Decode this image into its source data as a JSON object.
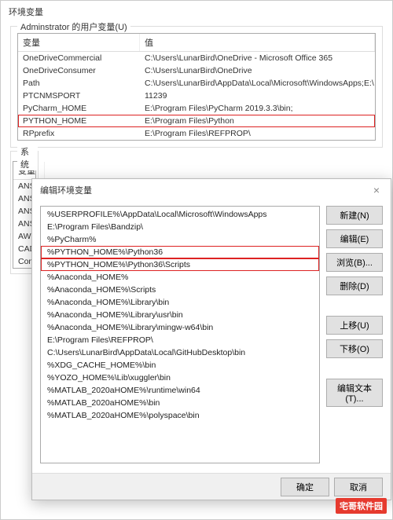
{
  "main": {
    "title": "环境变量",
    "userVarsLabel": "Adminstrator 的用户变量(U)"
  },
  "table": {
    "headerVar": "变量",
    "headerVal": "值",
    "rows": [
      {
        "k": "OneDriveCommercial",
        "v": "C:\\Users\\LunarBird\\OneDrive - Microsoft Office 365"
      },
      {
        "k": "OneDriveConsumer",
        "v": "C:\\Users\\LunarBird\\OneDrive"
      },
      {
        "k": "Path",
        "v": "C:\\Users\\LunarBird\\AppData\\Local\\Microsoft\\WindowsApps;E:\\"
      },
      {
        "k": "PTCNMSPORT",
        "v": "11239"
      },
      {
        "k": "PyCharm_HOME",
        "v": "E:\\Program Files\\PyCharm 2019.3.3\\bin;"
      },
      {
        "k": "PYTHON_HOME",
        "v": "E:\\Program Files\\Python"
      },
      {
        "k": "RPprefix",
        "v": "E:\\Program Files\\REFPROP\\"
      }
    ]
  },
  "sysLabel": "系统",
  "sysTable": {
    "headerVar": "变量",
    "rows": [
      "ANS",
      "ANS",
      "ANS",
      "ANS",
      "AWP",
      "CADC",
      "Com"
    ]
  },
  "dialog": {
    "title": "编辑环境变量",
    "items": [
      "%USERPROFILE%\\AppData\\Local\\Microsoft\\WindowsApps",
      "E:\\Program Files\\Bandzip\\",
      "%PyCharm%",
      "%PYTHON_HOME%\\Python36",
      "%PYTHON_HOME%\\Python36\\Scripts",
      "%Anaconda_HOME%",
      "%Anaconda_HOME%\\Scripts",
      "%Anaconda_HOME%\\Library\\bin",
      "%Anaconda_HOME%\\Library\\usr\\bin",
      "%Anaconda_HOME%\\Library\\mingw-w64\\bin",
      "E:\\Program Files\\REFPROP\\",
      "C:\\Users\\LunarBird\\AppData\\Local\\GitHubDesktop\\bin",
      "%XDG_CACHE_HOME%\\bin",
      "%YOZO_HOME%\\Lib\\xuggler\\bin",
      "%MATLAB_2020aHOME%\\runtime\\win64",
      "%MATLAB_2020aHOME%\\bin",
      "%MATLAB_2020aHOME%\\polyspace\\bin"
    ],
    "buttons": {
      "new": "新建(N)",
      "edit": "编辑(E)",
      "browse": "浏览(B)...",
      "delete": "删除(D)",
      "moveUp": "上移(U)",
      "moveDown": "下移(O)",
      "editText": "编辑文本(T)..."
    },
    "ok": "确定",
    "cancel": "取消"
  },
  "watermark": "宅哥软件园"
}
